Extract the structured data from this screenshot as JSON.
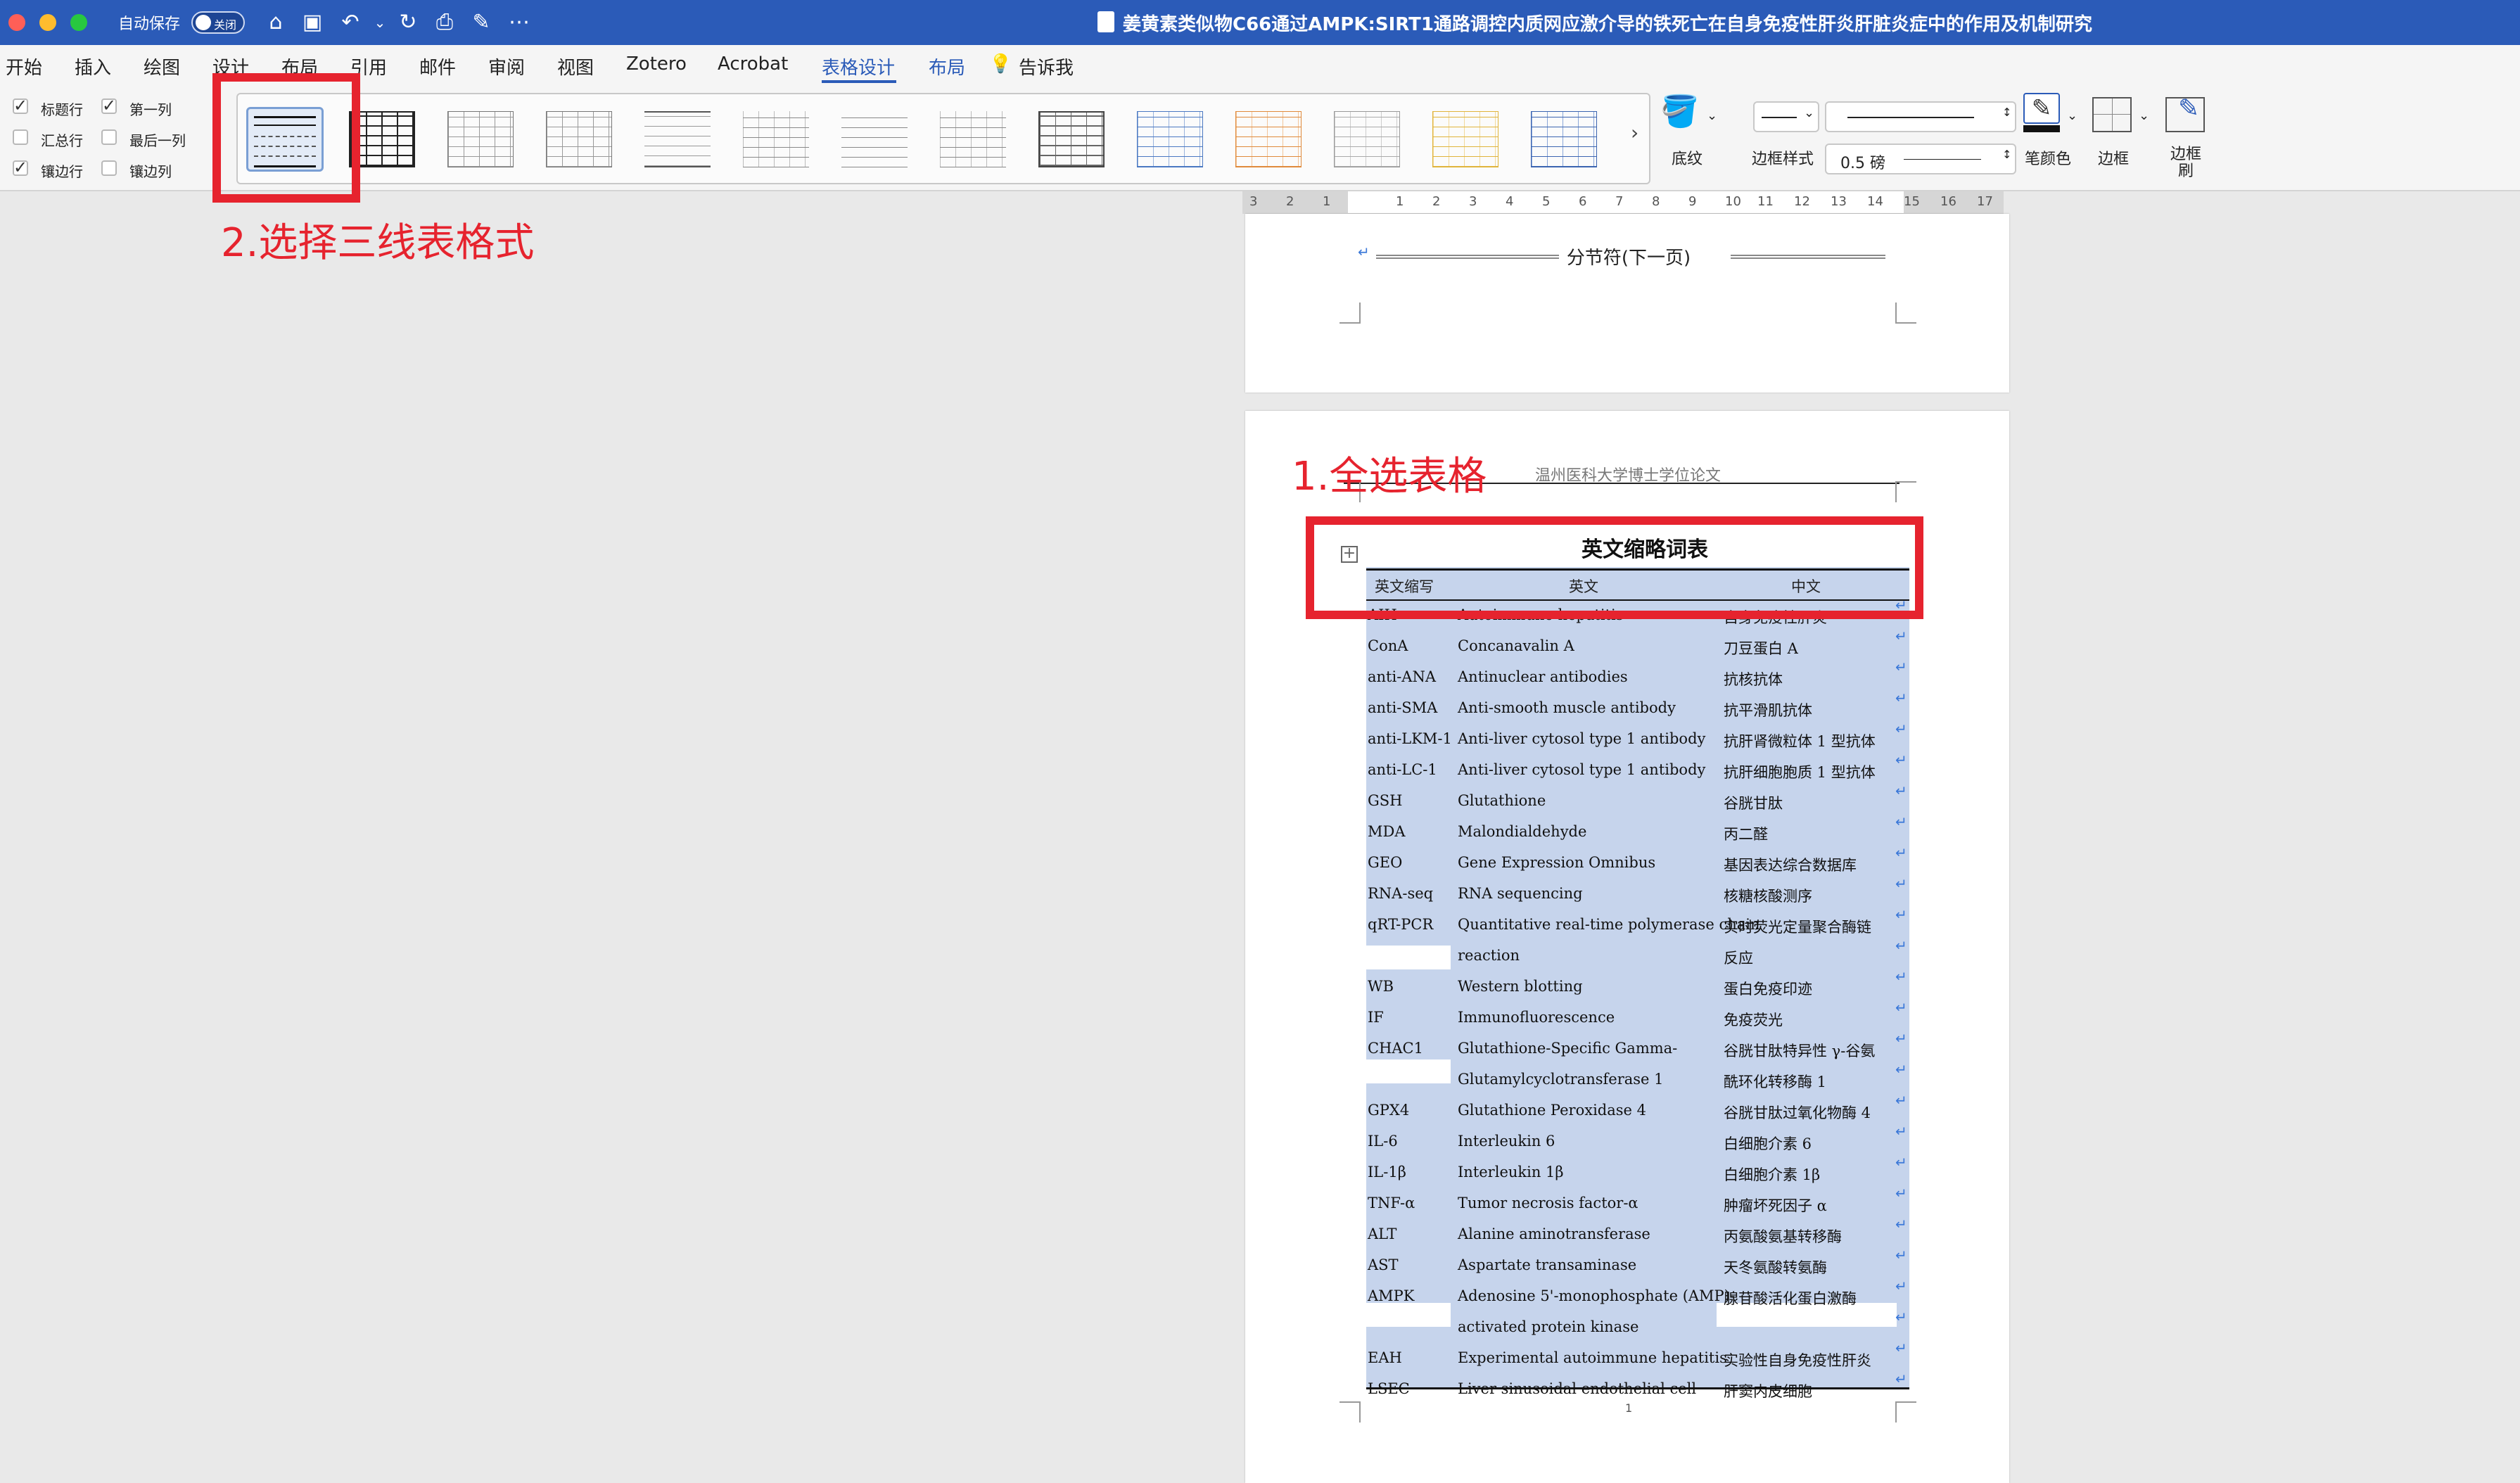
{
  "window": {
    "autosave_label": "自动保存",
    "autosave_toggle": "关闭",
    "doc_title": "姜黄素类似物C66通过AMPK:SIRT1通路调控内质网应激介导的铁死亡在自身免疫性肝炎肝脏炎症中的作用及机制研究"
  },
  "ribbon_tabs": [
    "开始",
    "插入",
    "绘图",
    "设计",
    "布局",
    "引用",
    "邮件",
    "审阅",
    "视图",
    "Zotero",
    "Acrobat",
    "表格设计",
    "布局",
    "告诉我"
  ],
  "style_options": {
    "header_row": "标题行",
    "first_column": "第一列",
    "total_row": "汇总行",
    "last_column": "最后一列",
    "banded_rows": "镶边行",
    "banded_columns": "镶边列"
  },
  "ribbon_right": {
    "shading": "底纹",
    "border_styles": "边框样式",
    "line_weight": "0.5 磅",
    "pen_color": "笔颜色",
    "borders": "边框",
    "border_painter": "边框刷"
  },
  "ruler_numbers": [
    "3",
    "2",
    "1",
    "1",
    "2",
    "3",
    "4",
    "5",
    "6",
    "7",
    "8",
    "9",
    "10",
    "11",
    "12",
    "13",
    "14",
    "15",
    "16",
    "17"
  ],
  "section_break": "分节符(下一页)",
  "page_header": "温州医科大学博士学位论文",
  "table": {
    "title": "英文缩略词表",
    "headers": [
      "英文缩写",
      "英文",
      "中文"
    ],
    "rows": [
      [
        "AIH",
        "Autoimmune hepatitis",
        "自身免疫性肝炎"
      ],
      [
        "ConA",
        "Concanavalin A",
        "刀豆蛋白 A"
      ],
      [
        "anti-ANA",
        "Antinuclear antibodies",
        "抗核抗体"
      ],
      [
        "anti-SMA",
        "Anti-smooth muscle antibody",
        "抗平滑肌抗体"
      ],
      [
        "anti-LKM-1",
        "Anti-liver cytosol type 1 antibody",
        "抗肝肾微粒体 1 型抗体"
      ],
      [
        "anti-LC-1",
        "Anti-liver cytosol type 1 antibody",
        "抗肝细胞胞质 1 型抗体"
      ],
      [
        "GSH",
        "Glutathione",
        "谷胱甘肽"
      ],
      [
        "MDA",
        "Malondialdehyde",
        "丙二醛"
      ],
      [
        "GEO",
        "Gene Expression Omnibus",
        "基因表达综合数据库"
      ],
      [
        "RNA-seq",
        "RNA sequencing",
        "核糖核酸测序"
      ],
      [
        "qRT-PCR",
        "Quantitative real-time polymerase chain",
        "实时荧光定量聚合酶链"
      ],
      [
        "",
        "reaction",
        "反应"
      ],
      [
        "WB",
        "Western blotting",
        "蛋白免疫印迹"
      ],
      [
        "IF",
        "Immunofluorescence",
        "免疫荧光"
      ],
      [
        "CHAC1",
        "Glutathione-Specific Gamma-",
        "谷胱甘肽特异性 γ-谷氨"
      ],
      [
        "",
        "Glutamylcyclotransferase 1",
        "酰环化转移酶 1"
      ],
      [
        "GPX4",
        "Glutathione Peroxidase 4",
        "谷胱甘肽过氧化物酶 4"
      ],
      [
        "IL-6",
        "Interleukin 6",
        "白细胞介素 6"
      ],
      [
        "IL-1β",
        "Interleukin 1β",
        "白细胞介素 1β"
      ],
      [
        "TNF-α",
        "Tumor necrosis factor-α",
        "肿瘤坏死因子 α"
      ],
      [
        "ALT",
        "Alanine aminotransferase",
        "丙氨酸氨基转移酶"
      ],
      [
        "AST",
        "Aspartate transaminase",
        "天冬氨酸转氨酶"
      ],
      [
        "AMPK",
        "Adenosine 5'-monophosphate (AMP)-",
        "腺苷酸活化蛋白激酶"
      ],
      [
        "",
        "activated protein kinase",
        ""
      ],
      [
        "EAH",
        "Experimental autoimmune hepatitis",
        "实验性自身免疫性肝炎"
      ],
      [
        "LSEC",
        "Liver sinusoidal endothelial cell",
        "肝窦内皮细胞"
      ]
    ]
  },
  "page_number": "1",
  "annotations": {
    "step1": "1.全选表格",
    "step2": "2.选择三线表格式"
  },
  "colors": {
    "titlebar": "#2b5bb8",
    "accent": "#2b5bb8",
    "annotation": "#e6232e",
    "selection": "#c6d4ec"
  }
}
